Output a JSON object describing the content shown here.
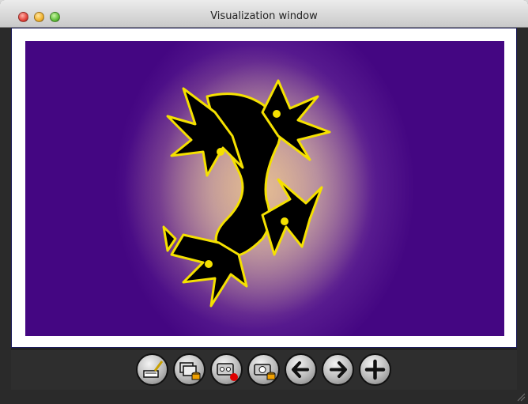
{
  "window": {
    "title": "Visualization window"
  },
  "traffic_lights": [
    "close",
    "minimize",
    "zoom"
  ],
  "visualization": {
    "subject": "Julia set fractal",
    "colors": {
      "background_outer": "#440682",
      "background_glow": "#d9b0a0",
      "fractal_fill": "#000000",
      "fractal_edge": "#f5e100"
    }
  },
  "toolbar": {
    "buttons": [
      {
        "id": "edit",
        "icon": "brush-edit-icon"
      },
      {
        "id": "save-windows",
        "icon": "windows-database-icon"
      },
      {
        "id": "record",
        "icon": "tape-record-icon"
      },
      {
        "id": "snapshot",
        "icon": "camera-database-icon"
      },
      {
        "id": "back",
        "icon": "arrow-left-icon"
      },
      {
        "id": "forward",
        "icon": "arrow-right-icon"
      },
      {
        "id": "zoom-in",
        "icon": "plus-icon"
      }
    ]
  }
}
